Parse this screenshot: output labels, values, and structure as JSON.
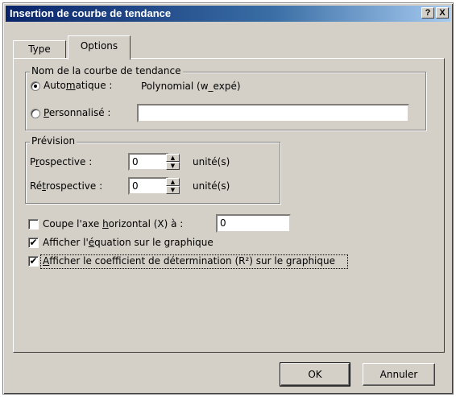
{
  "window": {
    "title": "Insertion de courbe de tendance",
    "help_btn": "?",
    "close_btn": "X"
  },
  "tabs": [
    {
      "label": "Type",
      "active": false
    },
    {
      "label": "Options",
      "active": true
    }
  ],
  "name_group": {
    "legend": "Nom de la courbe de tendance",
    "auto_label": "Automatique :",
    "auto_value": "Polynomial (w_expé)",
    "auto_selected": true,
    "custom_label": "Personnalisé :",
    "custom_value": ""
  },
  "forecast_group": {
    "legend": "Prévision",
    "forward_label": "Prospective :",
    "forward_value": "0",
    "backward_label": "Rétrospective :",
    "backward_value": "0",
    "unit": "unité(s)"
  },
  "options": {
    "intercept_label": "Coupe l'axe horizontal (X) à :",
    "intercept_checked": false,
    "intercept_value": "0",
    "equation_label": "Afficher l'équation sur le graphique",
    "equation_checked": true,
    "r2_label": "Afficher le coefficient de détermination (R²) sur le graphique",
    "r2_checked": true
  },
  "buttons": {
    "ok": "OK",
    "cancel": "Annuler"
  },
  "icons": {
    "check": "✔",
    "spin_up": "▲",
    "spin_down": "▼"
  }
}
